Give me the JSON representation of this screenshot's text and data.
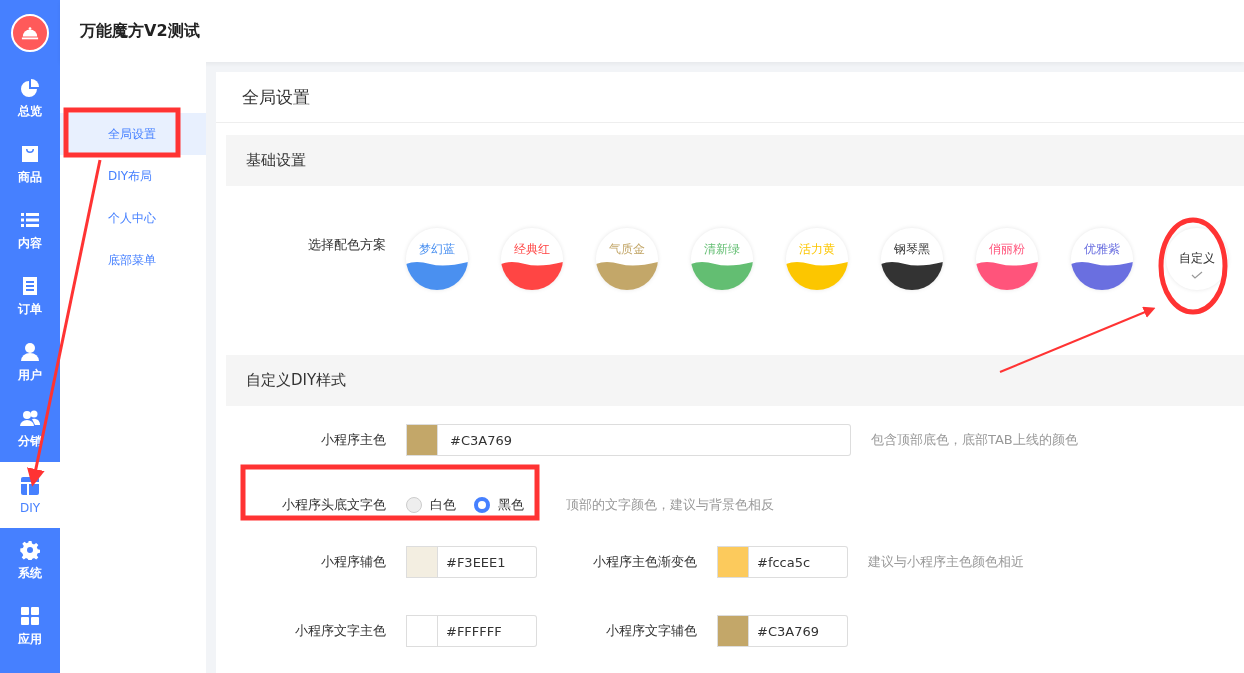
{
  "header": {
    "title": "万能魔方V2测试"
  },
  "nav": [
    {
      "kind": "pie",
      "label": "总览",
      "selected": false
    },
    {
      "kind": "bag",
      "label": "商品",
      "selected": false
    },
    {
      "kind": "list",
      "label": "内容",
      "selected": false
    },
    {
      "kind": "doc",
      "label": "订单",
      "selected": false
    },
    {
      "kind": "user",
      "label": "用户",
      "selected": false
    },
    {
      "kind": "users",
      "label": "分销",
      "selected": false
    },
    {
      "kind": "layout",
      "label": "DIY",
      "selected": true
    },
    {
      "kind": "gear",
      "label": "系统",
      "selected": false
    },
    {
      "kind": "grid",
      "label": "应用",
      "selected": false
    }
  ],
  "submenu": [
    {
      "label": "全局设置",
      "selected": true
    },
    {
      "label": "DIY布局",
      "selected": false
    },
    {
      "label": "个人中心",
      "selected": false
    },
    {
      "label": "底部菜单",
      "selected": false
    }
  ],
  "page_title": "全局设置",
  "basic": {
    "title": "基础设置",
    "label": "选择配色方案",
    "schemes": [
      {
        "kind": "preset",
        "name": "梦幻蓝",
        "color": "#4a90f0",
        "selected": false
      },
      {
        "kind": "preset",
        "name": "经典红",
        "color": "#ff4544",
        "selected": false
      },
      {
        "kind": "preset",
        "name": "气质金",
        "color": "#c3a769",
        "selected": false
      },
      {
        "kind": "preset",
        "name": "清新绿",
        "color": "#63be72",
        "selected": false
      },
      {
        "kind": "preset",
        "name": "活力黄",
        "color": "#fcc600",
        "selected": false
      },
      {
        "kind": "preset",
        "name": "钢琴黑",
        "color": "#333333",
        "selected": false
      },
      {
        "kind": "preset",
        "name": "俏丽粉",
        "color": "#ff547b",
        "selected": false
      },
      {
        "kind": "preset",
        "name": "优雅紫",
        "color": "#6a6fe0",
        "selected": false
      },
      {
        "kind": "custom",
        "name": "自定义",
        "selected": true
      }
    ]
  },
  "custom": {
    "title": "自定义DIY样式",
    "rows": [
      {
        "items": [
          {
            "kind": "color",
            "label": "小程序主色",
            "color": "#c3a769",
            "value": "#C3A769"
          }
        ],
        "hint": "包含顶部底色，底部TAB上线的颜色"
      },
      {
        "items": [
          {
            "kind": "radio",
            "label": "小程序头底文字色",
            "options": [
              {
                "label": "白色",
                "selected": false
              },
              {
                "label": "黑色",
                "selected": true
              }
            ]
          }
        ],
        "hint": "顶部的文字颜色，建议与背景色相反"
      },
      {
        "items": [
          {
            "kind": "color",
            "label": "小程序辅色",
            "color": "#f3eee1",
            "value": "#F3EEE1"
          },
          {
            "kind": "color",
            "label": "小程序主色渐变色",
            "color": "#fcca5c",
            "value": "#fcca5c"
          }
        ],
        "hint": "建议与小程序主色颜色相近"
      },
      {
        "items": [
          {
            "kind": "color",
            "label": "小程序文字主色",
            "color": "#ffffff",
            "value": "#FFFFFF"
          },
          {
            "kind": "color",
            "label": "小程序文字辅色",
            "color": "#c3a769",
            "value": "#C3A769"
          }
        ]
      }
    ]
  }
}
